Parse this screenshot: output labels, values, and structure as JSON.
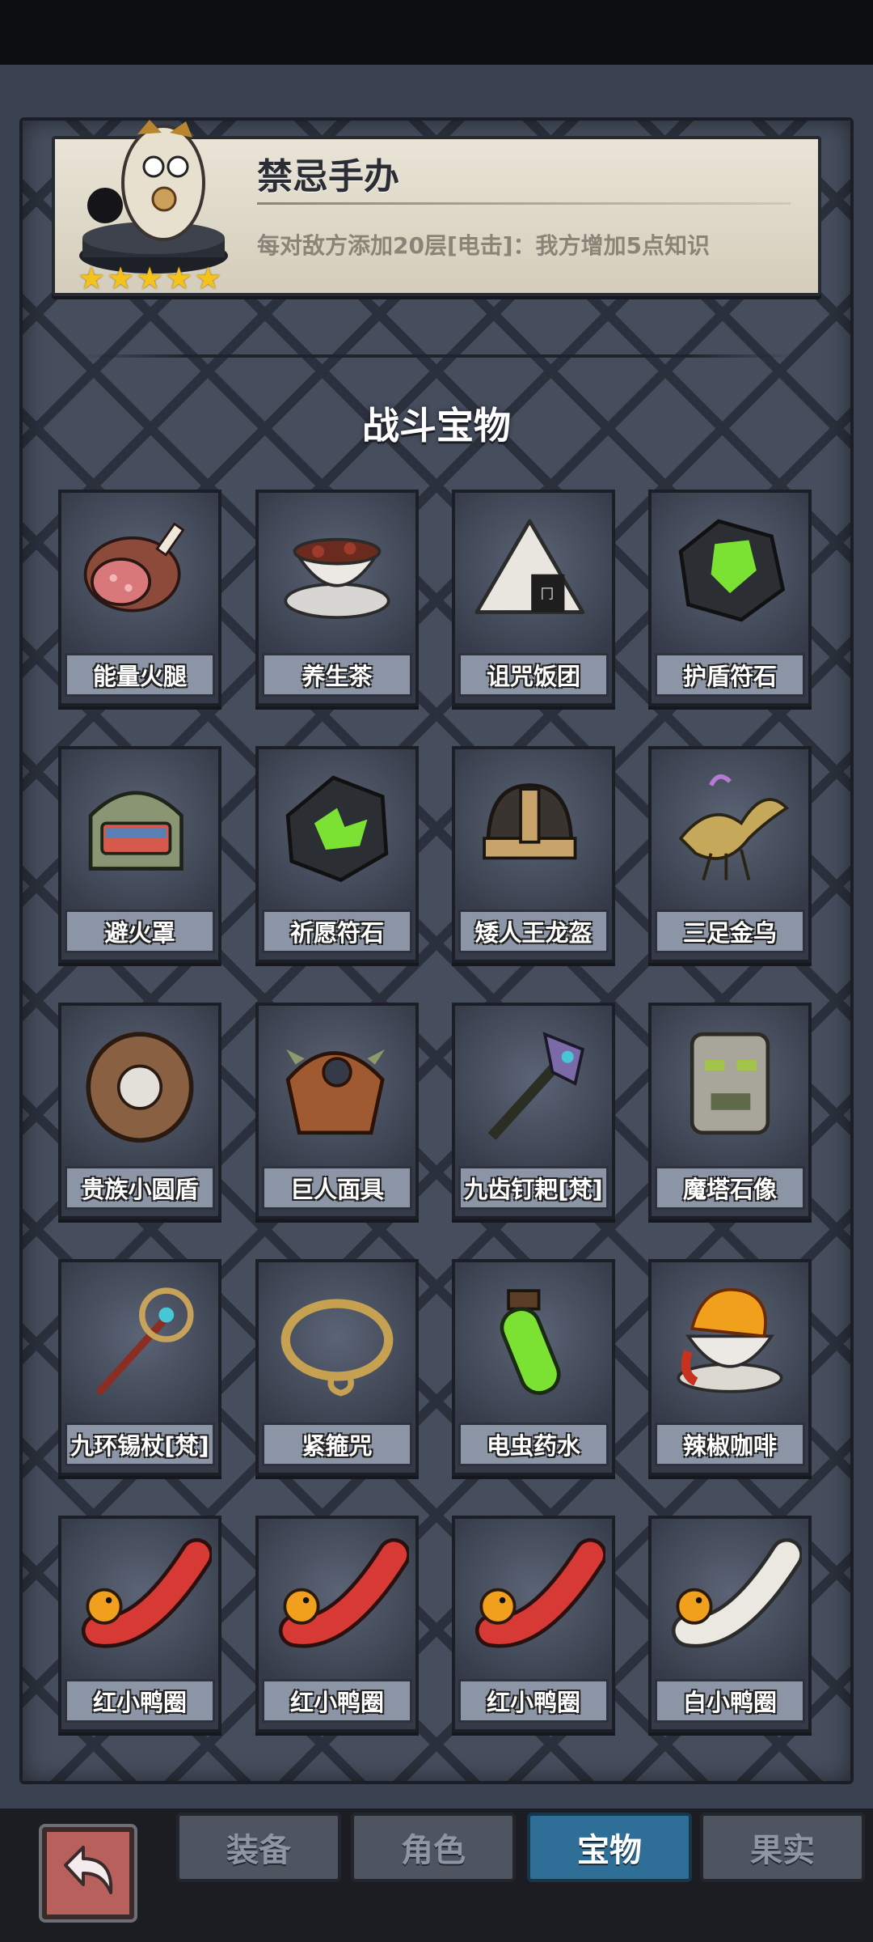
{
  "banner": {
    "title": "禁忌手办",
    "description": "每对敌方添加20层[电击]：我方增加5点知识",
    "stars": 5
  },
  "section_title": "战斗宝物",
  "items": [
    {
      "label": "能量火腿",
      "icon": "ham-icon"
    },
    {
      "label": "养生茶",
      "icon": "tea-cup-icon"
    },
    {
      "label": "诅咒饭团",
      "icon": "rice-ball-icon"
    },
    {
      "label": "护盾符石",
      "icon": "shield-rune-icon"
    },
    {
      "label": "避火罩",
      "icon": "fire-helmet-icon"
    },
    {
      "label": "祈愿符石",
      "icon": "wish-rune-icon"
    },
    {
      "label": "矮人王龙盔",
      "icon": "dwarf-helmet-icon"
    },
    {
      "label": "三足金乌",
      "icon": "golden-bird-icon"
    },
    {
      "label": "贵族小圆盾",
      "icon": "round-shield-icon"
    },
    {
      "label": "巨人面具",
      "icon": "giant-mask-icon"
    },
    {
      "label": "九齿钉耙[梵]",
      "icon": "rake-icon"
    },
    {
      "label": "魔塔石像",
      "icon": "stone-statue-icon"
    },
    {
      "label": "九环锡杖[梵]",
      "icon": "staff-icon"
    },
    {
      "label": "紧箍咒",
      "icon": "golden-circlet-icon"
    },
    {
      "label": "电虫药水",
      "icon": "potion-icon"
    },
    {
      "label": "辣椒咖啡",
      "icon": "chili-coffee-icon"
    },
    {
      "label": "红小鸭圈",
      "icon": "red-duck-ring-icon"
    },
    {
      "label": "红小鸭圈",
      "icon": "red-duck-ring-icon"
    },
    {
      "label": "红小鸭圈",
      "icon": "red-duck-ring-icon"
    },
    {
      "label": "白小鸭圈",
      "icon": "white-duck-ring-icon"
    }
  ],
  "tabs": [
    {
      "label": "装备",
      "active": false
    },
    {
      "label": "角色",
      "active": false
    },
    {
      "label": "宝物",
      "active": true
    },
    {
      "label": "果实",
      "active": false
    }
  ],
  "colors": {
    "active_tab": "#2f6f97",
    "label_bg": "#8b95a5",
    "star": "#f5c21a"
  }
}
